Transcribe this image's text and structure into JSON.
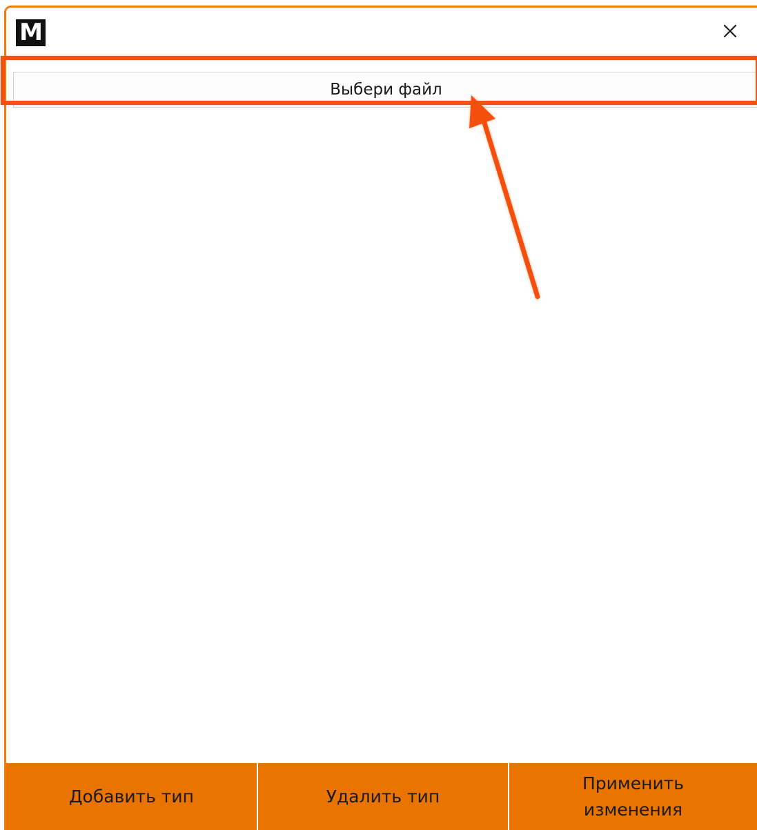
{
  "app": {
    "icon_letter": "M",
    "icon_name": "app-logo-icon",
    "close_icon": "close-icon"
  },
  "file_picker": {
    "label": "Выбери файл"
  },
  "actions": {
    "add_type": "Добавить тип",
    "remove_type": "Удалить тип",
    "apply_changes": "Применить\nизменения"
  },
  "colors": {
    "accent": "#ea7400",
    "window_border": "#ee7b0e",
    "annotation": "#f55010"
  }
}
